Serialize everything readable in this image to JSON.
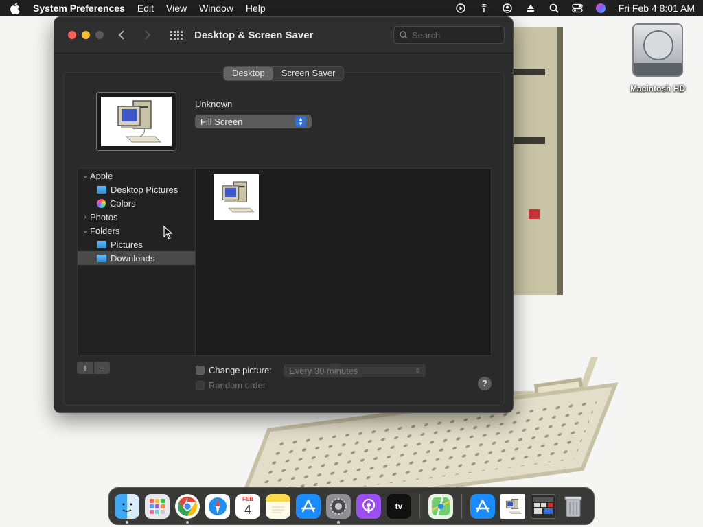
{
  "menubar": {
    "app_name": "System Preferences",
    "items": [
      "Edit",
      "View",
      "Window",
      "Help"
    ],
    "clock": "Fri Feb 4  8:01 AM",
    "status_icons": [
      "screen-recording-icon",
      "antenna-icon",
      "user-account-icon",
      "eject-icon",
      "spotlight-search-icon",
      "control-center-icon",
      "siri-icon"
    ]
  },
  "desktop": {
    "drive_label": "Macintosh HD"
  },
  "window": {
    "title": "Desktop & Screen Saver",
    "search_placeholder": "Search",
    "tabs": [
      {
        "label": "Desktop",
        "active": true
      },
      {
        "label": "Screen Saver",
        "active": false
      }
    ],
    "picture_name": "Unknown",
    "fill_mode": "Fill Screen",
    "sidebar": {
      "apple": "Apple",
      "desktop_pictures": "Desktop Pictures",
      "colors": "Colors",
      "photos": "Photos",
      "folders": "Folders",
      "pictures": "Pictures",
      "downloads": "Downloads"
    },
    "add_label": "+",
    "remove_label": "−",
    "change_picture_label": "Change picture:",
    "interval_value": "Every 30 minutes",
    "random_order_label": "Random order",
    "help_label": "?"
  },
  "dock": {
    "calendar_month": "FEB",
    "calendar_day": "4",
    "tv_label": "tv",
    "apps": [
      "Finder",
      "Launchpad",
      "Chrome",
      "Safari",
      "Calendar",
      "Notes",
      "App Store",
      "System Preferences",
      "Podcasts",
      "TV",
      "Maps",
      "Applications",
      "Desktop Picture",
      "Screenshot",
      "Trash"
    ]
  },
  "colors": {
    "accent": "#2f6fd6",
    "close": "#fe5f57",
    "minimize": "#febc2e"
  }
}
